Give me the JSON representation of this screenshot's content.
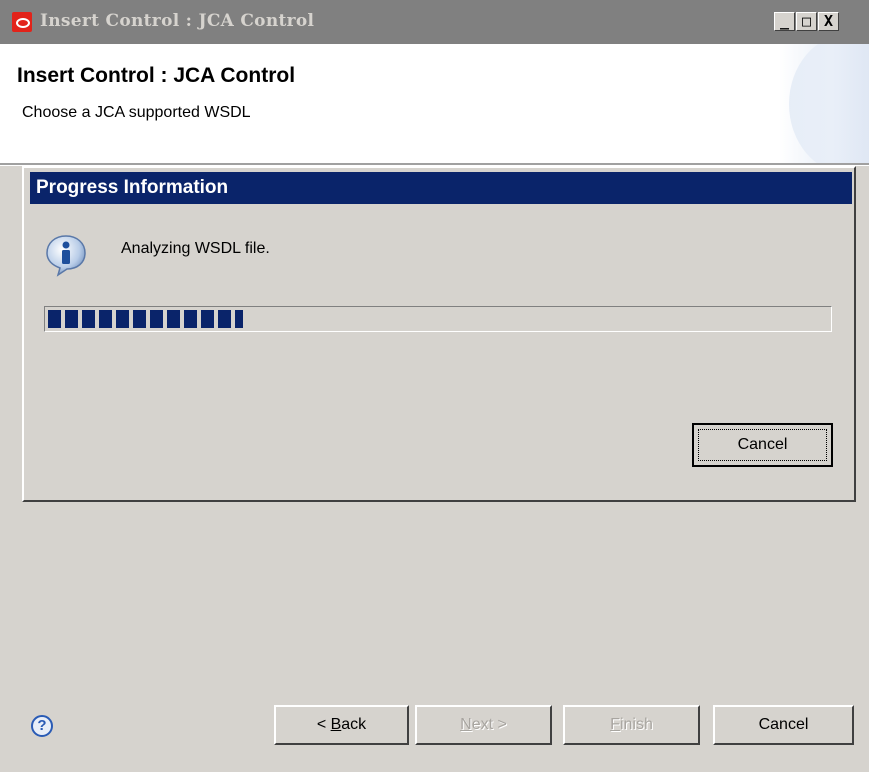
{
  "window": {
    "title": "Insert Control : JCA Control",
    "controls": {
      "minimize": "_",
      "maximize": "□",
      "close": "X"
    }
  },
  "header": {
    "title": "Insert Control : JCA Control",
    "subtitle": "Choose a JCA supported WSDL"
  },
  "progress_dialog": {
    "title": "Progress Information",
    "message": "Analyzing WSDL file.",
    "progress_fraction": 0.25,
    "cancel_label": "Cancel",
    "icon": "info-icon"
  },
  "buttons": {
    "back": {
      "prefix": "< ",
      "mnemonic": "B",
      "rest": "ack",
      "enabled": true
    },
    "next": {
      "mnemonic": "N",
      "rest": "ext >",
      "enabled": false
    },
    "finish": {
      "mnemonic": "F",
      "rest": "inish",
      "enabled": false
    },
    "cancel": {
      "label": "Cancel",
      "enabled": true
    }
  },
  "help": {
    "symbol": "?"
  },
  "colors": {
    "dialog_title_bg": "#0a246a",
    "progress_fill": "#0a246a",
    "window_bg": "#d6d3ce"
  }
}
